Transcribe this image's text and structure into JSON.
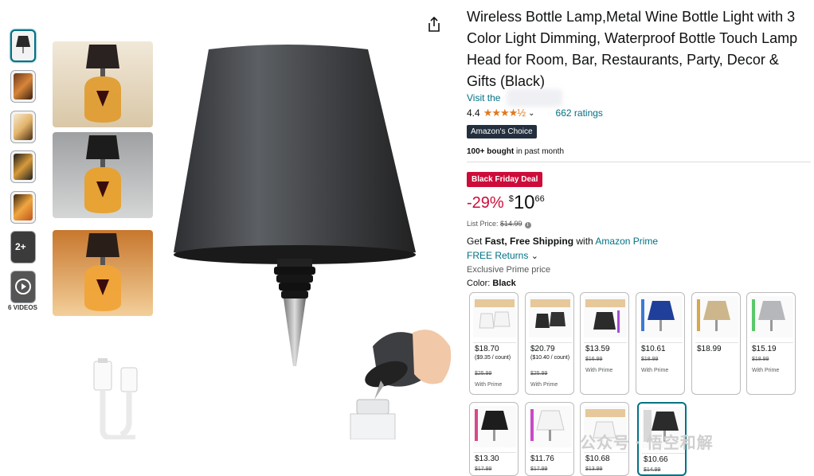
{
  "product": {
    "title": "Wireless Bottle Lamp,Metal Wine Bottle Light with 3 Color Light Dimming, Waterproof Bottle Touch Lamp Head for Room, Bar, Restaurants, Party, Decor & Gifts (Black)",
    "visit_store": "Visit the",
    "rating_value": "4.4",
    "stars": "★★★★½",
    "ratings_count": "662 ratings",
    "badge": "Amazon's Choice",
    "bought_bold": "100+ bought",
    "bought_rest": " in past month",
    "deal_badge": "Black Friday Deal",
    "discount": "-29%",
    "currency": "$",
    "price_whole": "10",
    "price_fraction": "66",
    "list_price_label": "List Price: ",
    "list_price": "$14.99",
    "ship_get": "Get ",
    "ship_bold": "Fast, Free Shipping",
    "ship_with": " with ",
    "ship_prime": "Amazon Prime",
    "free_returns": "FREE Returns",
    "exclusive": "Exclusive Prime price",
    "color_label": "Color: ",
    "color_value": "Black"
  },
  "media": {
    "videos_label": "6 VIDEOS",
    "thumb_badge": "2+"
  },
  "swatches": [
    {
      "price": "$18.70",
      "sub": "($9.35 / count)",
      "was": "$25.99",
      "prime": "With Prime"
    },
    {
      "price": "$20.79",
      "sub": "($10.40 / count)",
      "was": "$25.99",
      "prime": "With Prime"
    },
    {
      "price": "$13.59",
      "sub": "",
      "was": "$16.99",
      "prime": "With Prime"
    },
    {
      "price": "$10.61",
      "sub": "",
      "was": "$18.99",
      "prime": "With Prime"
    },
    {
      "price": "$18.99",
      "sub": "",
      "was": "",
      "prime": ""
    },
    {
      "price": "$15.19",
      "sub": "",
      "was": "$18.99",
      "prime": "With Prime"
    },
    {
      "price": "$13.30",
      "sub": "",
      "was": "$17.99",
      "prime": ""
    },
    {
      "price": "$11.76",
      "sub": "",
      "was": "$17.99",
      "prime": ""
    },
    {
      "price": "$10.68",
      "sub": "",
      "was": "$13.99",
      "prime": ""
    },
    {
      "price": "$10.66",
      "sub": "",
      "was": "$14.99",
      "prime": ""
    }
  ],
  "watermark": "公众号 · 悟空和解",
  "colors": {
    "link": "#007185",
    "deal": "#cc0c39",
    "star": "#de7921",
    "badge_bg": "#232f3e"
  }
}
